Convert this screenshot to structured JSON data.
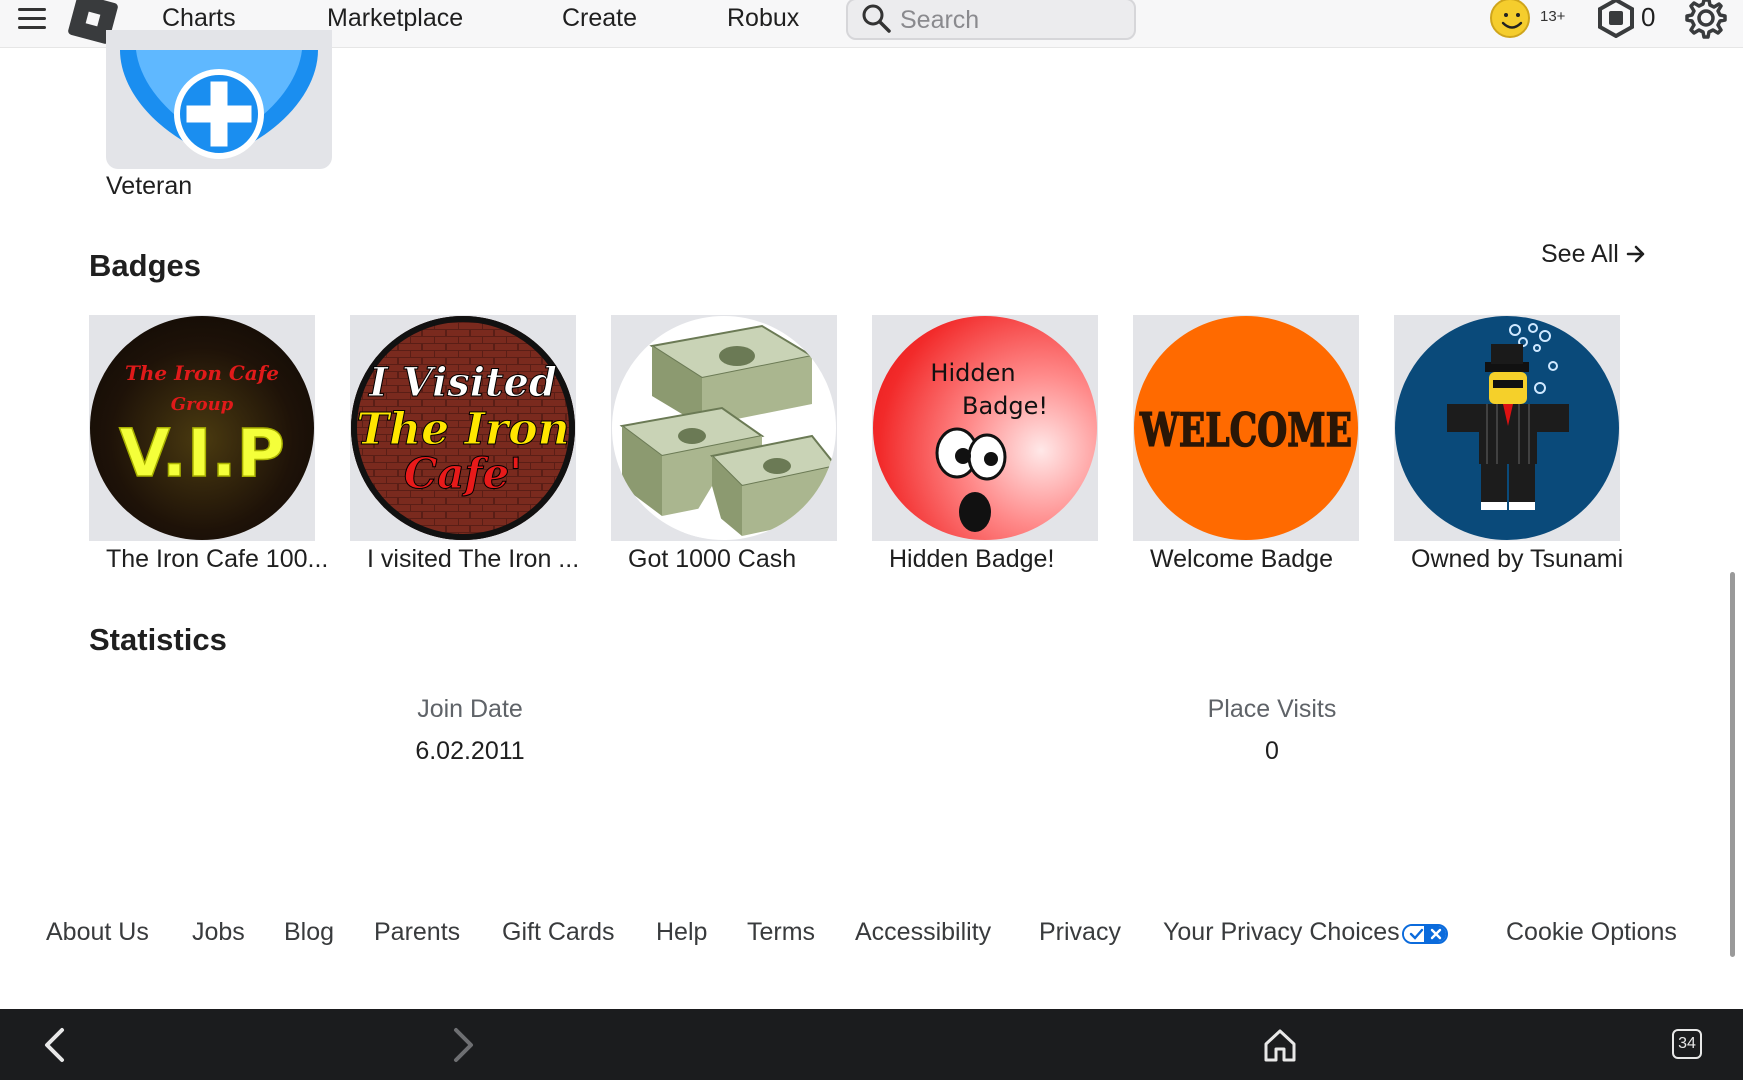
{
  "nav": {
    "links": [
      "Charts",
      "Marketplace",
      "Create",
      "Robux"
    ],
    "search_placeholder": "Search",
    "age_label": "13+",
    "robux_count": "0"
  },
  "veteran": {
    "label": "Veteran"
  },
  "badges": {
    "title": "Badges",
    "see_all": "See All",
    "items": [
      {
        "label": "The Iron Cafe 100...",
        "icon": "vip-badge-image",
        "art_text": [
          "The Iron Cafe",
          "Group",
          "V.I.P"
        ]
      },
      {
        "label": "I visited The Iron ...",
        "icon": "visited-iron-cafe-badge-image",
        "art_text": [
          "I Visited",
          "The Iron",
          "Cafe'"
        ]
      },
      {
        "label": "Got 1000 Cash",
        "icon": "cash-stack-badge-image"
      },
      {
        "label": "Hidden Badge!",
        "icon": "hidden-badge-image",
        "art_text": [
          "Hidden",
          "Badge!"
        ]
      },
      {
        "label": "Welcome Badge",
        "icon": "welcome-badge-image",
        "art_text": [
          "WELCOME"
        ]
      },
      {
        "label": "Owned by Tsunami",
        "icon": "tsunami-avatar-badge-image"
      }
    ]
  },
  "statistics": {
    "title": "Statistics",
    "join_date_label": "Join Date",
    "join_date_value": "6.02.2011",
    "place_visits_label": "Place Visits",
    "place_visits_value": "0"
  },
  "footer": {
    "links": [
      "About Us",
      "Jobs",
      "Blog",
      "Parents",
      "Gift Cards",
      "Help",
      "Terms",
      "Accessibility",
      "Privacy",
      "Your Privacy Choices",
      "Cookie Options"
    ]
  },
  "browser": {
    "tabs_count": "34"
  },
  "colors": {
    "accent": "#0b6bdc",
    "tile_bg": "#e3e4e8",
    "bottom_bar": "#1b1c1e"
  }
}
